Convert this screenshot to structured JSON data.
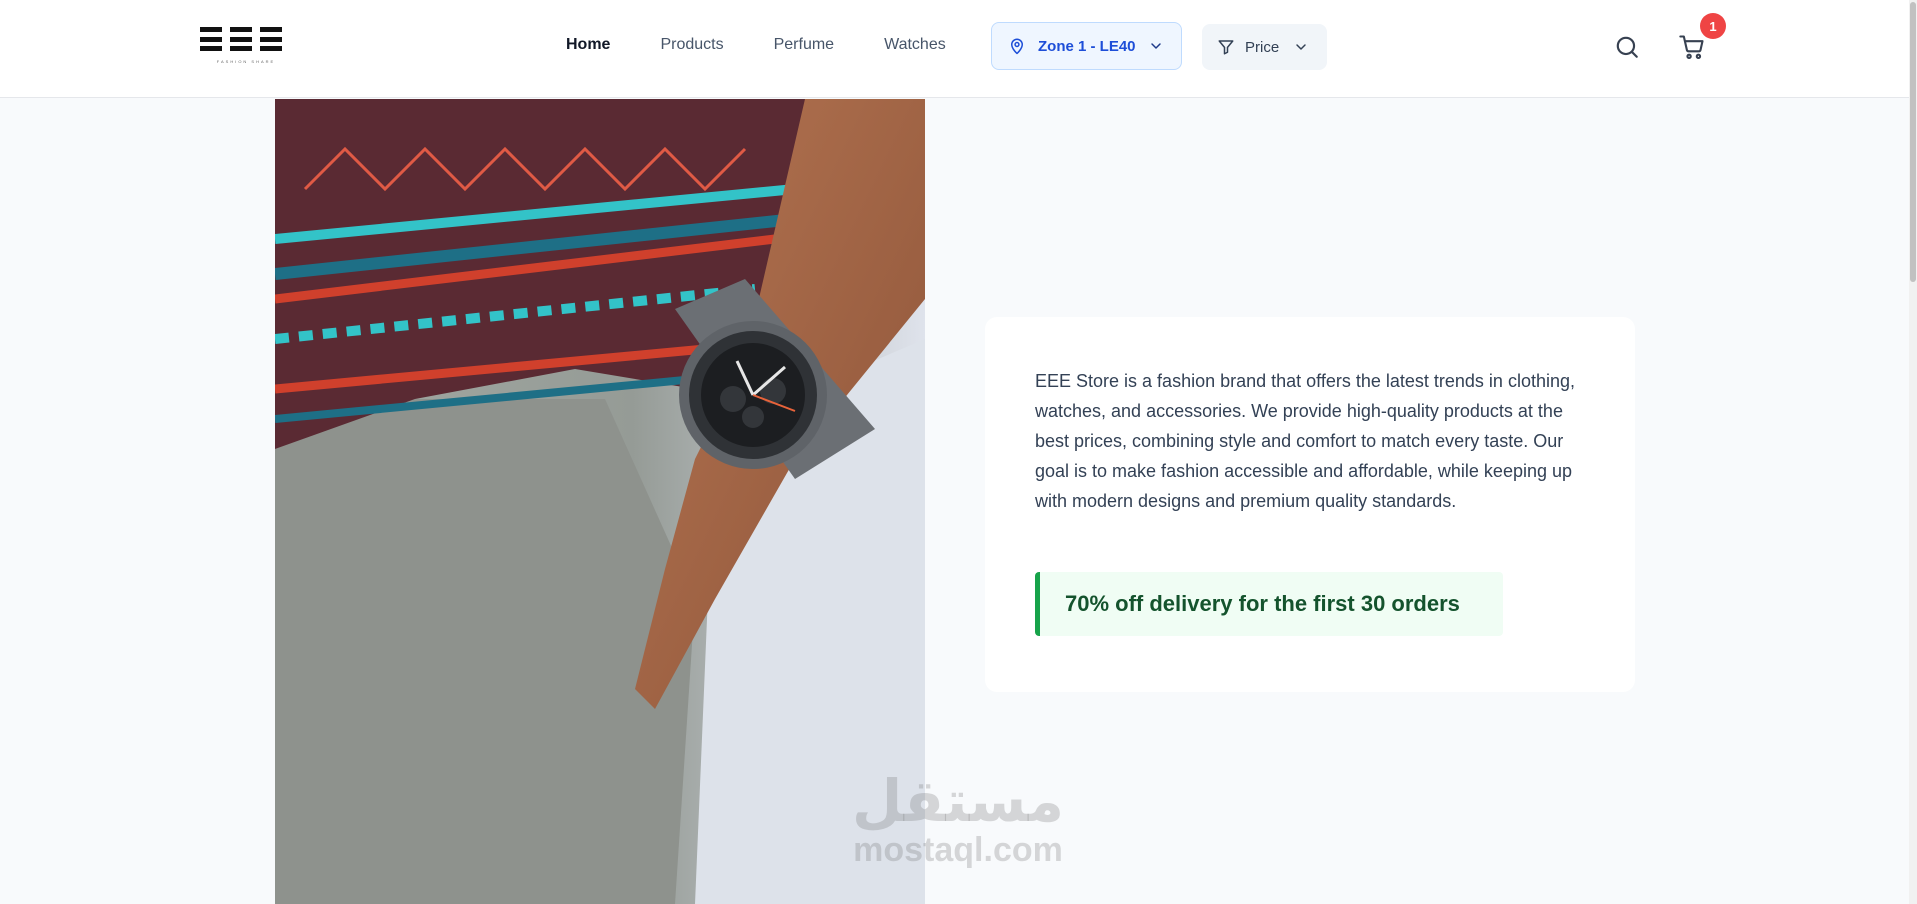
{
  "header": {
    "logo": {
      "text": "EEE",
      "tagline": "FASHION SHARE"
    },
    "nav": [
      {
        "label": "Home",
        "active": true
      },
      {
        "label": "Products",
        "active": false
      },
      {
        "label": "Perfume",
        "active": false
      },
      {
        "label": "Watches",
        "active": false
      }
    ],
    "zone_selector": {
      "label": "Zone 1 - LE40",
      "icon": "map-pin-icon"
    },
    "price_filter": {
      "label": "Price",
      "icon": "filter-icon"
    },
    "search_icon": "search-icon",
    "cart": {
      "icon": "cart-icon",
      "badge_count": "1"
    }
  },
  "hero": {
    "image": "man-wearing-chronograph-wristwatch-photo"
  },
  "about": {
    "text": "EEE Store is a fashion brand that offers the latest trends in clothing, watches, and accessories. We provide high-quality products at the best prices, combining style and comfort to match every taste. Our goal is to make fashion accessible and affordable, while keeping up with modern designs and premium quality standards.",
    "promo": "70% off delivery for the first 30 orders"
  },
  "watermark": {
    "arabic": "مستقل",
    "latin": "mostaql.com"
  },
  "colors": {
    "accent_blue": "#1d4ed8",
    "promo_green": "#16a34a",
    "badge_red": "#ef4444"
  }
}
